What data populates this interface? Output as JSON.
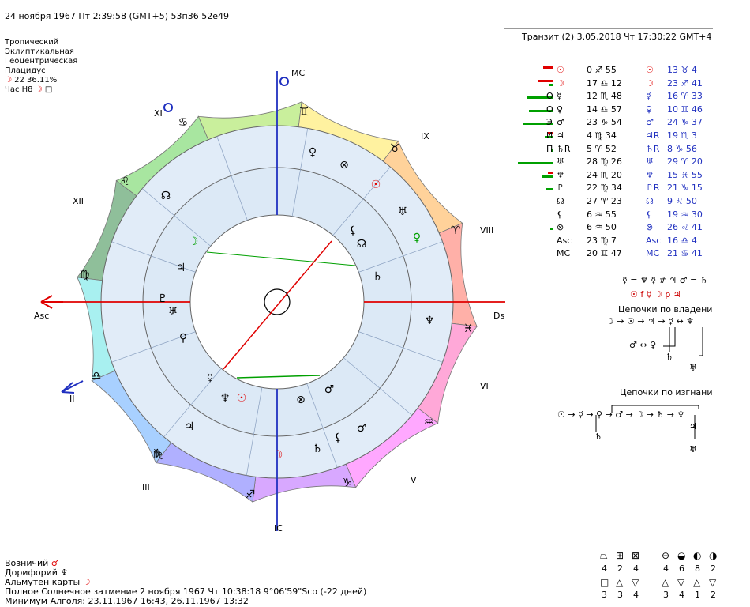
{
  "header": {
    "date_line": "24 ноября 1967  Пт    2:39:58 (GMT+5)  53п36  52е49",
    "transit_line": "Транзит (2)  3.05.2018   Чт 17:30:22 GMT+4"
  },
  "params": {
    "zodiac": "Тропический",
    "plane": "Эклиптикальная",
    "center": "Геоцентрическая",
    "houses": "Плацидус",
    "moon_line": "22 36.11%",
    "hour_line": "Час Н8"
  },
  "chart_labels": {
    "asc": "Asc",
    "ds": "Ds",
    "mc": "MC",
    "ic": "IC",
    "houses": [
      "II",
      "III",
      "V",
      "VI",
      "VIII",
      "IX",
      "XI",
      "XII"
    ]
  },
  "planets": [
    {
      "natal_glyph": "☉",
      "natal_pos": "0 ♐ 55",
      "transit_glyph": "☉",
      "transit_pos": "13 ♉ 4"
    },
    {
      "natal_glyph": "☽",
      "natal_pos": "17 ♎ 12",
      "transit_glyph": "☽",
      "transit_pos": "23 ♐ 41"
    },
    {
      "natal_glyph": "☿",
      "natal_pos": "12 ♏ 48",
      "transit_glyph": "☿",
      "transit_pos": "16 ♈ 33"
    },
    {
      "natal_glyph": "♀",
      "natal_pos": "14 ♎ 57",
      "transit_glyph": "♀",
      "transit_pos": "10 ♊ 46"
    },
    {
      "natal_glyph": "♂",
      "natal_pos": "23 ♑ 54",
      "transit_glyph": "♂",
      "transit_pos": "24 ♑ 37"
    },
    {
      "natal_glyph": "♃",
      "natal_pos": "4 ♍ 34",
      "transit_glyph": "♃R",
      "transit_pos": "19 ♏ 3"
    },
    {
      "natal_glyph": "♄R",
      "natal_pos": "5 ♈ 52",
      "transit_glyph": "♄R",
      "transit_pos": "8 ♑ 56"
    },
    {
      "natal_glyph": "♅",
      "natal_pos": "28 ♍ 26",
      "transit_glyph": "♅",
      "transit_pos": "29 ♈ 20"
    },
    {
      "natal_glyph": "♆",
      "natal_pos": "24 ♏ 20",
      "transit_glyph": "♆",
      "transit_pos": "15 ♓ 55"
    },
    {
      "natal_glyph": "♇",
      "natal_pos": "22 ♍ 34",
      "transit_glyph": "♇R",
      "transit_pos": "21 ♑ 15"
    },
    {
      "natal_glyph": "☊",
      "natal_pos": "27 ♈ 23",
      "transit_glyph": "☊",
      "transit_pos": "9 ♌ 50"
    },
    {
      "natal_glyph": "⚸",
      "natal_pos": "6 ♒ 55",
      "transit_glyph": "⚸",
      "transit_pos": "19 ♒ 30"
    },
    {
      "natal_glyph": "⊗",
      "natal_pos": "6 ♒ 50",
      "transit_glyph": "⊗",
      "transit_pos": "26 ♌ 41"
    },
    {
      "natal_glyph": "Asc",
      "natal_pos": "23 ♍ 7",
      "transit_glyph": "Asc",
      "transit_pos": "16 ♎ 4"
    },
    {
      "natal_glyph": "MC",
      "natal_pos": "20 ♊ 47",
      "transit_glyph": "MC",
      "transit_pos": "21 ♋ 41"
    }
  ],
  "markers": [
    "",
    "",
    "О",
    "О",
    "Э",
    "И",
    "П",
    "",
    "",
    "",
    "",
    "",
    "",
    "",
    ""
  ],
  "strength_bars": [
    {
      "red": 12,
      "green": 0
    },
    {
      "red": 18,
      "green": 4
    },
    {
      "red": 0,
      "green": 32
    },
    {
      "red": 0,
      "green": 30
    },
    {
      "red": 0,
      "green": 38
    },
    {
      "red": 6,
      "green": 10
    },
    {
      "red": 0,
      "green": 2
    },
    {
      "red": 0,
      "green": 44
    },
    {
      "red": 6,
      "green": 14
    },
    {
      "red": 0,
      "green": 8
    },
    {
      "red": 0,
      "green": 0
    },
    {
      "red": 0,
      "green": 0
    },
    {
      "red": 0,
      "green": 3
    },
    {
      "red": 0,
      "green": 0
    },
    {
      "red": 0,
      "green": 0
    }
  ],
  "aspect_lines": {
    "line1": "☿ = ♆ ☿ # ♃ ♂ = ♄",
    "line2": "☉ f ☿ ☽ p ♃"
  },
  "chains": {
    "rule_title": "Цепочки по владени",
    "rule_main": "☽ → ☉ → ♃ → ☿ ↔ ♆",
    "rule_sub1": "♂ ↔ ♀",
    "rule_sub2": "♄",
    "rule_sub3": "♅",
    "exile_title": "Цепочки по изгнани",
    "exile_main": "☉ → ☿ → ♀ → ♂ → ☽ → ♄ → ♆",
    "exile_sub1": "♄",
    "exile_sub2": "♃",
    "exile_sub3": "♅"
  },
  "footer": {
    "vozn_label": "Возничий",
    "vozn_val": "♂",
    "dorif_label": "Дорифорий",
    "dorif_val": "♆",
    "almuten_label": "Альмутен карты",
    "almuten_val": "☽",
    "eclipse": "Полное Солнечное затмение 2 ноября 1967  Чт 10:38:18  9°06'59\"Sco (-22 дней)",
    "algol": "Минимум Алголя: 23.11.1967 16:43,   26.11.1967 13:32"
  },
  "bottom_counts": {
    "row1": [
      "4",
      "2",
      "4",
      "4",
      "6",
      "8",
      "2"
    ],
    "row2": [
      "3",
      "3",
      "4",
      "3",
      "4",
      "1",
      "2"
    ]
  },
  "colors": {
    "accent_red": "#e00000",
    "accent_blue": "#2030c0",
    "aspect_green": "#00a000"
  }
}
